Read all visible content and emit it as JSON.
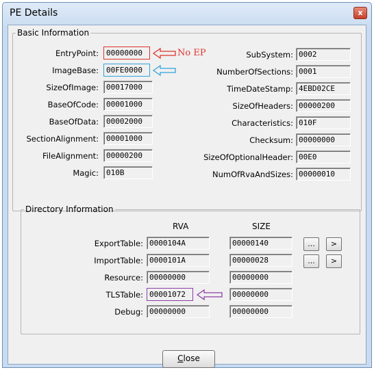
{
  "window": {
    "title": "PE Details",
    "close_glyph": "x"
  },
  "basic": {
    "legend": "Basic Information",
    "left": [
      {
        "label": "EntryPoint:",
        "value": "00000000"
      },
      {
        "label": "ImageBase:",
        "value": "00FE0000"
      },
      {
        "label": "SizeOfImage:",
        "value": "00017000"
      },
      {
        "label": "BaseOfCode:",
        "value": "00001000"
      },
      {
        "label": "BaseOfData:",
        "value": "00002000"
      },
      {
        "label": "SectionAlignment:",
        "value": "00001000"
      },
      {
        "label": "FileAlignment:",
        "value": "00000200"
      },
      {
        "label": "Magic:",
        "value": "010B"
      }
    ],
    "right": [
      {
        "label": "SubSystem:",
        "value": "0002"
      },
      {
        "label": "NumberOfSections:",
        "value": "0001"
      },
      {
        "label": "TimeDateStamp:",
        "value": "4EBD02CE"
      },
      {
        "label": "SizeOfHeaders:",
        "value": "00000200"
      },
      {
        "label": "Characteristics:",
        "value": "010F"
      },
      {
        "label": "Checksum:",
        "value": "00000000"
      },
      {
        "label": "SizeOfOptionalHeader:",
        "value": "00E0"
      },
      {
        "label": "NumOfRvaAndSizes:",
        "value": "00000010"
      }
    ],
    "annotation": "No EP"
  },
  "directory": {
    "legend": "Directory Information",
    "col_rva": "RVA",
    "col_size": "SIZE",
    "rows": [
      {
        "label": "ExportTable:",
        "rva": "0000104A",
        "size": "00000140"
      },
      {
        "label": "ImportTable:",
        "rva": "0000101A",
        "size": "00000028"
      },
      {
        "label": "Resource:",
        "rva": "00000000",
        "size": "00000000"
      },
      {
        "label": "TLSTable:",
        "rva": "00001072",
        "size": "00000000"
      },
      {
        "label": "Debug:",
        "rva": "00000000",
        "size": "00000000"
      }
    ],
    "more_label": "...",
    "go_label": ">"
  },
  "footer": {
    "close_mnemonic": "C",
    "close_rest": "lose"
  },
  "colors": {
    "red": "#e0322b",
    "blue": "#2fa3dc",
    "purple": "#8c3fa8"
  }
}
